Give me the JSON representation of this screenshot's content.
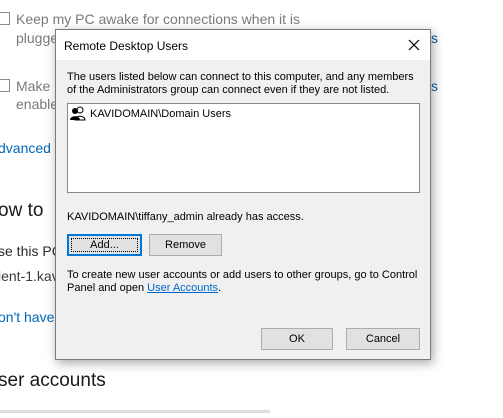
{
  "background": {
    "keep_awake_line1": "Keep my PC awake for connections when it is",
    "keep_awake_line2": "plugge",
    "make_line1": "Make",
    "make_line2": "enable",
    "link_s1": "s",
    "link_s2": "s",
    "advanced_link": "dvanced s",
    "how_to_heading": "ow to",
    "use_this_pc": "se this PC",
    "client_name": "ient-1.kav",
    "dont_have_link": "on't have",
    "user_accounts_heading": "ser accounts"
  },
  "dialog": {
    "title": "Remote Desktop Users",
    "description": "The users listed below can connect to this computer, and any members of the Administrators group can connect even if they are not listed.",
    "users": [
      {
        "name": "KAVIDOMAIN\\Domain Users",
        "icon": "user-group-icon"
      }
    ],
    "access_text": "KAVIDOMAIN\\tiffany_admin already has access.",
    "add_button": "Add...",
    "remove_button": "Remove",
    "info_text": "To create new user accounts or add users to other groups, go to Control Panel and open ",
    "info_link": "User Accounts",
    "info_suffix": ".",
    "ok_button": "OK",
    "cancel_button": "Cancel"
  }
}
